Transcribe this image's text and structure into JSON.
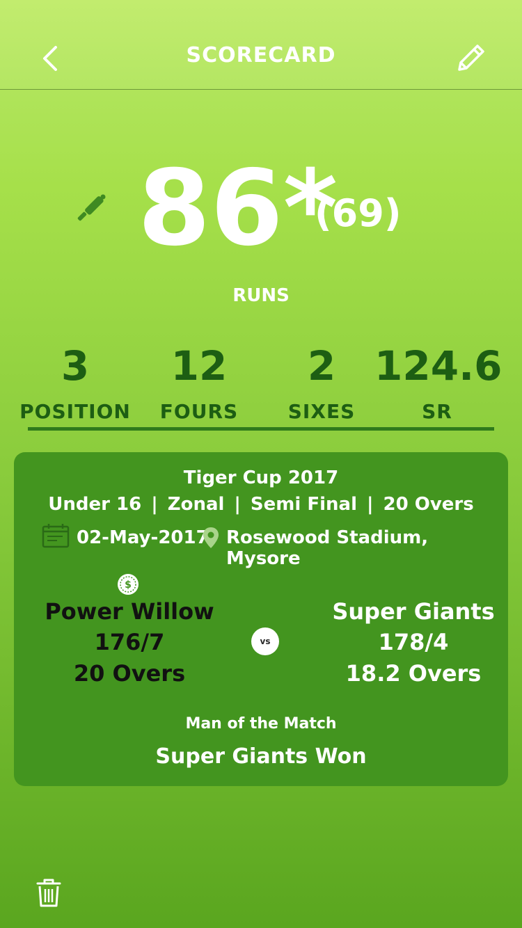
{
  "header": {
    "title": "SCORECARD",
    "back_icon": "chevron-left-icon",
    "edit_icon": "pencil-icon"
  },
  "score": {
    "runs": "86*",
    "balls": "(69)",
    "label": "RUNS",
    "icon": "cricket-bat-icon"
  },
  "stats": [
    {
      "value": "3",
      "label": "POSITION"
    },
    {
      "value": "12",
      "label": "FOURS"
    },
    {
      "value": "2",
      "label": "SIXES"
    },
    {
      "value": "124.6",
      "label": "SR"
    }
  ],
  "match": {
    "tournament": "Tiger Cup 2017",
    "age_group": "Under 16",
    "level": "Zonal",
    "stage": "Semi Final",
    "format": "20 Overs",
    "date": "02-May-2017",
    "venue": "Rosewood Stadium, Mysore",
    "vs_label": "vs",
    "team_a": {
      "name": "Power Willow",
      "score": "176/7",
      "overs": "20 Overs"
    },
    "team_b": {
      "name": "Super Giants",
      "score": "178/4",
      "overs": "18.2 Overs"
    },
    "motm_label": "Man of the Match",
    "result": "Super Giants Won"
  },
  "colors": {
    "card": "#43951f",
    "stat_text": "#1d5e13",
    "accent_dark": "#2f7a1c"
  },
  "footer": {
    "delete_icon": "trash-icon"
  }
}
